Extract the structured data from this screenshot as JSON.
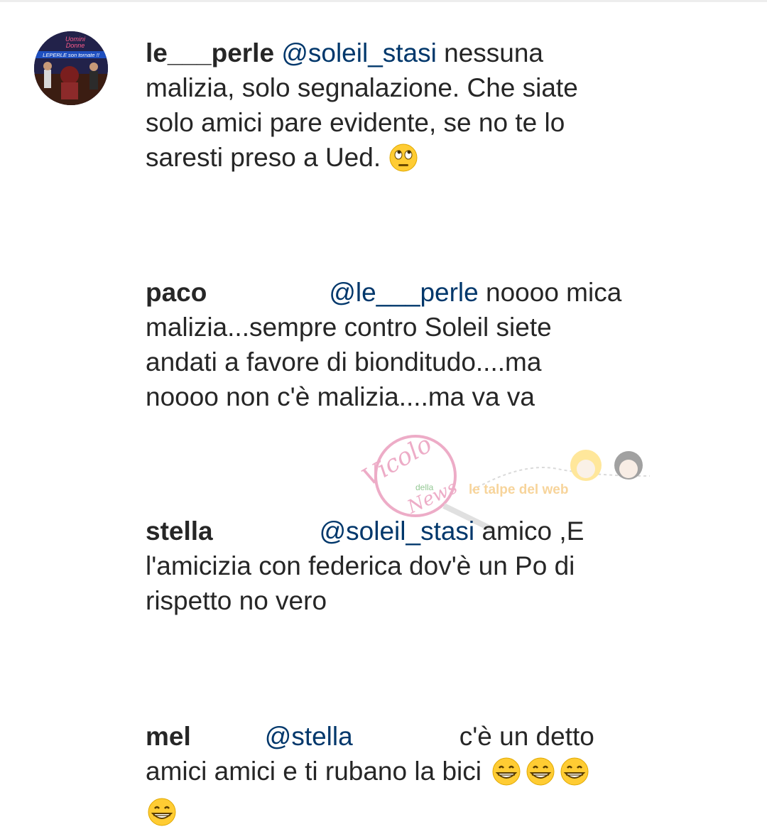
{
  "comments": [
    {
      "user": "le___perle",
      "mention": "@soleil_stasi",
      "lines": [
        "nessuna",
        "malizia, solo segnalazione. Che siate",
        "solo amici pare evidente, se no te lo",
        "saresti preso a Ued."
      ],
      "emoji": [
        "face-with-rolling-eyes-icon"
      ]
    },
    {
      "user": "paco",
      "mention": "@le___perle",
      "lines": [
        "noooo mica",
        "malizia...sempre contro Soleil siete",
        "andati a favore di bionditudo....ma",
        "noooo non c'è malizia....ma va va"
      ]
    },
    {
      "user": "stella",
      "mention": "@soleil_stasi",
      "lines": [
        "amico ,E",
        "l'amicizia con federica dov'è un Po di",
        "rispetto no vero"
      ]
    },
    {
      "user": "mel",
      "mention": "@stella",
      "lines": [
        "c'è un detto",
        "amici amici e ti rubano la bici"
      ],
      "emoji": [
        "grinning-face-icon",
        "grinning-face-icon",
        "grinning-face-icon",
        "grinning-face-icon"
      ]
    }
  ],
  "avatar": {
    "caption_1": "Uomini",
    "caption_2": "Donne",
    "banner": "LEPERLE son tornate !!"
  },
  "watermark": {
    "logo_1": "Vicolo",
    "logo_2": "della",
    "logo_3": "News",
    "logo_4": "le talpe del web"
  },
  "colors": {
    "text": "#262626",
    "mention": "#00376b",
    "emoji_yellow": "#ffcc33"
  }
}
